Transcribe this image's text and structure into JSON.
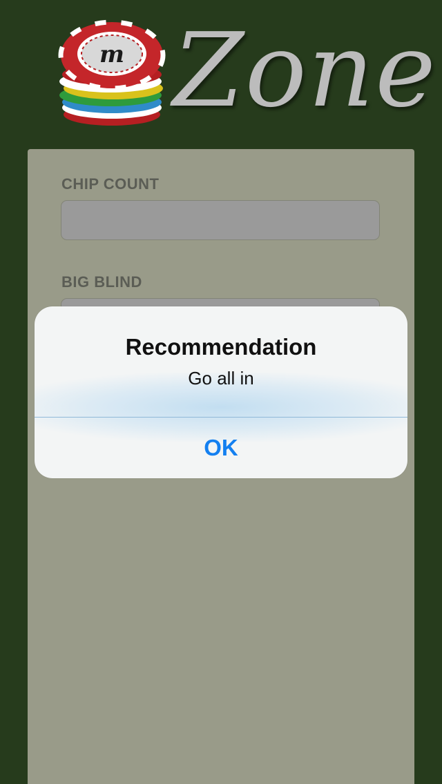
{
  "app": {
    "logo_mark": "m",
    "logo_word": "Zone"
  },
  "form": {
    "chip_count_label": "CHIP COUNT",
    "chip_count_value": "",
    "big_blind_label": "BIG BLIND",
    "big_blind_value": ""
  },
  "alert": {
    "title": "Recommendation",
    "message": "Go all in",
    "ok_label": "OK"
  },
  "colors": {
    "background": "#263b1c",
    "panel": "#999b89",
    "accent": "#1480f0"
  },
  "icons": {
    "logo": "poker-chip-stack-icon"
  }
}
